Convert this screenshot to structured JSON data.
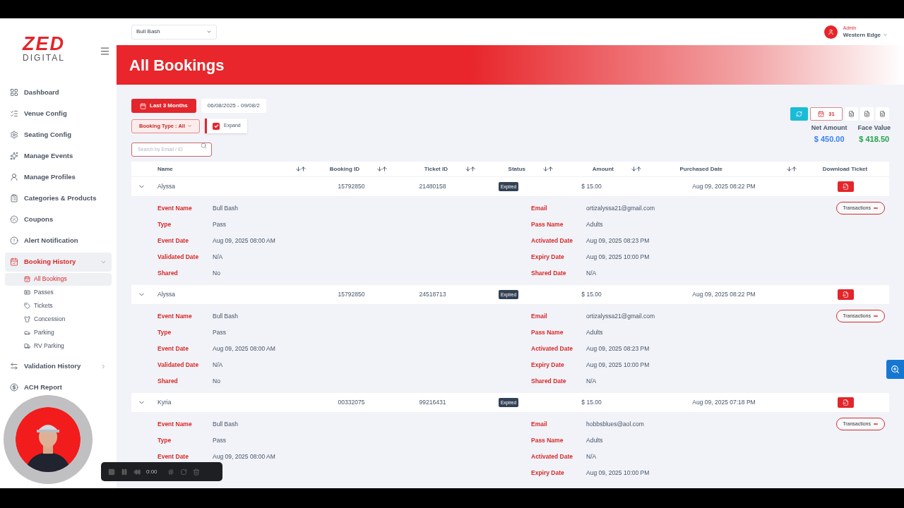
{
  "logo": {
    "mark": "ZED",
    "sub": "DIGITAL"
  },
  "sidebar": {
    "items": [
      {
        "label": "Dashboard",
        "selected": false
      },
      {
        "label": "Venue Config",
        "selected": false
      },
      {
        "label": "Seating Config",
        "selected": false
      },
      {
        "label": "Manage Events",
        "selected": false
      },
      {
        "label": "Manage Profiles",
        "selected": false
      },
      {
        "label": "Categories & Products",
        "selected": false
      },
      {
        "label": "Coupons",
        "selected": false
      },
      {
        "label": "Alert Notification",
        "selected": false
      },
      {
        "label": "Booking History",
        "selected": true,
        "expanded": true,
        "children": [
          {
            "label": "All Bookings",
            "selected": true
          },
          {
            "label": "Passes",
            "selected": false
          },
          {
            "label": "Tickets",
            "selected": false
          },
          {
            "label": "Concession",
            "selected": false
          },
          {
            "label": "Parking",
            "selected": false
          },
          {
            "label": "RV Parking",
            "selected": false
          }
        ]
      },
      {
        "label": "Validation History",
        "selected": false,
        "expanded": false
      },
      {
        "label": "ACH Report",
        "selected": false
      }
    ]
  },
  "event_select": {
    "value": "Bull Bash"
  },
  "user": {
    "role": "Admin",
    "name": "Western Edge"
  },
  "page_title": "All Bookings",
  "filters": {
    "range_button": "Last 3 Months",
    "date_range": "06/08/2025 - 09/08/2",
    "booking_type": "Booking Type : All",
    "expand": {
      "label": "Expand",
      "checked": true
    },
    "search": {
      "placeholder": "Search by Email / ID"
    }
  },
  "toolbar": {
    "calendar_count": "31"
  },
  "totals": [
    {
      "label": "Net Amount",
      "value": "$ 450.00",
      "color": "#3b82f6"
    },
    {
      "label": "Face Value",
      "value": "$ 418.50",
      "color": "#22a34a"
    }
  ],
  "table": {
    "columns": [
      "Name",
      "Booking ID",
      "Ticket ID",
      "Status",
      "Amount",
      "Purchased Date",
      "Download Ticket"
    ],
    "rows": [
      {
        "expanded": true,
        "name": "Alyssa",
        "booking_id": "15792850",
        "ticket_id": "21480158",
        "status": "Expired",
        "amount": "$ 15.00",
        "purchased": "Aug 09, 2025 08:22 PM",
        "transactions": "Transactions",
        "left": [
          {
            "label": "Event Name",
            "value": "Bull Bash"
          },
          {
            "label": "Type",
            "value": "Pass"
          },
          {
            "label": "Event Date",
            "value": "Aug 09, 2025 08:00 AM"
          },
          {
            "label": "Validated Date",
            "value": "N/A"
          },
          {
            "label": "Shared",
            "value": "No"
          }
        ],
        "right": [
          {
            "label": "Email",
            "value": "ortizalyssa21@gmail.com"
          },
          {
            "label": "Pass Name",
            "value": "Adults"
          },
          {
            "label": "Activated Date",
            "value": "Aug 09, 2025 08:23 PM"
          },
          {
            "label": "Expiry Date",
            "value": "Aug 09, 2025 10:00 PM"
          },
          {
            "label": "Shared Date",
            "value": "N/A"
          }
        ]
      },
      {
        "expanded": true,
        "name": "Alyssa",
        "booking_id": "15792850",
        "ticket_id": "24518713",
        "status": "Expired",
        "amount": "$ 15.00",
        "purchased": "Aug 09, 2025 08:22 PM",
        "transactions": "Transactions",
        "left": [
          {
            "label": "Event Name",
            "value": "Bull Bash"
          },
          {
            "label": "Type",
            "value": "Pass"
          },
          {
            "label": "Event Date",
            "value": "Aug 09, 2025 08:00 AM"
          },
          {
            "label": "Validated Date",
            "value": "N/A"
          },
          {
            "label": "Shared",
            "value": "No"
          }
        ],
        "right": [
          {
            "label": "Email",
            "value": "ortizalyssa21@gmail.com"
          },
          {
            "label": "Pass Name",
            "value": "Adults"
          },
          {
            "label": "Activated Date",
            "value": "Aug 09, 2025 08:23 PM"
          },
          {
            "label": "Expiry Date",
            "value": "Aug 09, 2025 10:00 PM"
          },
          {
            "label": "Shared Date",
            "value": "N/A"
          }
        ]
      },
      {
        "expanded": true,
        "name": "Kyria",
        "booking_id": "00332075",
        "ticket_id": "99216431",
        "status": "Expired",
        "amount": "$ 15.00",
        "purchased": "Aug 09, 2025 07:18 PM",
        "transactions": "Transactions",
        "left": [
          {
            "label": "Event Name",
            "value": "Bull Bash"
          },
          {
            "label": "Type",
            "value": "Pass"
          },
          {
            "label": "Event Date",
            "value": "Aug 09, 2025 08:00 AM"
          }
        ],
        "right": [
          {
            "label": "Email",
            "value": "hobbsblues@aol.com"
          },
          {
            "label": "Pass Name",
            "value": "Adults"
          },
          {
            "label": "Activated Date",
            "value": "N/A"
          },
          {
            "label": "Expiry Date",
            "value": "Aug 09, 2025 10:00 PM"
          }
        ]
      }
    ]
  },
  "recorder": {
    "time": "0:00"
  }
}
